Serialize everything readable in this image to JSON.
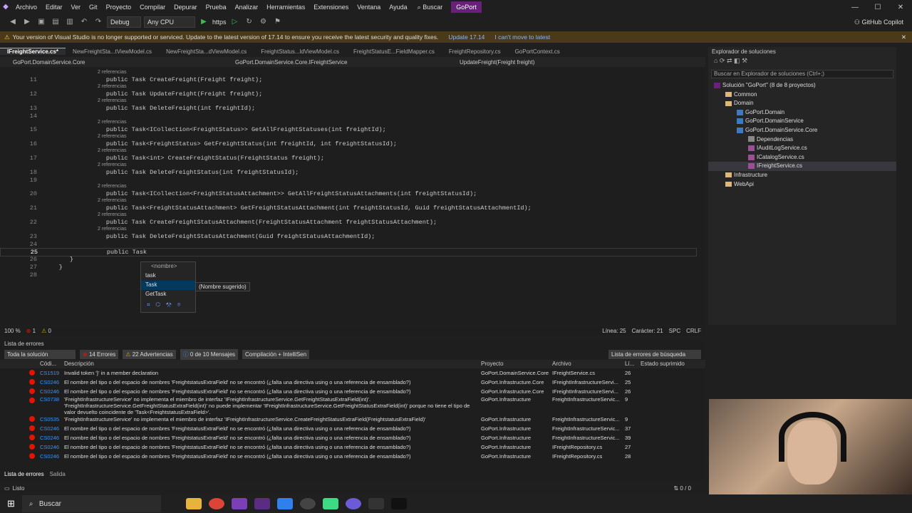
{
  "menu": [
    "Archivo",
    "Editar",
    "Ver",
    "Git",
    "Proyecto",
    "Compilar",
    "Depurar",
    "Prueba",
    "Analizar",
    "Herramientas",
    "Extensiones",
    "Ventana",
    "Ayuda"
  ],
  "search_label": "Buscar",
  "project_name": "GoPort",
  "toolbar": {
    "config": "Debug",
    "platform": "Any CPU",
    "run_target": "https",
    "copilot": "GitHub Copilot"
  },
  "infobar": {
    "message": "Your version of Visual Studio is no longer supported or serviced. Update to the latest version of 17.14 to ensure you receive the latest security and quality fixes.",
    "update_link": "Update 17.14",
    "dismiss_link": "I can't move to latest"
  },
  "tabs": [
    "IFreightService.cs*",
    "NewFreightSta...tViewModel.cs",
    "NewFreightSta...dViewModel.cs",
    "FreightStatus...ldViewModel.cs",
    "FreightStatusE...FieldMapper.cs",
    "FreightRepository.cs",
    "GoPortContext.cs"
  ],
  "navbar": {
    "project": "GoPort.DomainService.Core",
    "type": "GoPort.DomainService.Core.IFreightService",
    "member": "UpdateFreight(Freight freight)"
  },
  "code_refs": "2 referencias",
  "code": [
    {
      "n": "11",
      "t": "public Task CreateFreight(Freight freight);"
    },
    {
      "n": "12",
      "t": "public Task UpdateFreight(Freight freight);"
    },
    {
      "n": "13",
      "t": "public Task DeleteFreight(int freightId);"
    },
    {
      "n": "14",
      "t": ""
    },
    {
      "n": "15",
      "t": "public Task<ICollection<FreightStatus>> GetAllFreightStatuses(int freightId);"
    },
    {
      "n": "16",
      "t": "public Task<FreightStatus> GetFreightStatus(int freightId, int freightStatusId);"
    },
    {
      "n": "17",
      "t": "public Task<int> CreateFreightStatus(FreightStatus freight);"
    },
    {
      "n": "18",
      "t": "public Task DeleteFreightStatus(int freightStatusId);"
    },
    {
      "n": "19",
      "t": ""
    },
    {
      "n": "20",
      "t": "public Task<ICollection<FreightStatusAttachment>> GetAllFreightStatusAttachments(int freightStatusId);"
    },
    {
      "n": "21",
      "t": "public Task<FreightStatusAttachment> GetFreightStatusAttachment(int freightStatusId, Guid freightStatusAttachmentId);"
    },
    {
      "n": "22",
      "t": "public Task CreateFreightStatusAttachment(FreightStatusAttachment freightStatusAttachment);"
    },
    {
      "n": "23",
      "t": "public Task DeleteFreightStatusAttachment(Guid freightStatusAttachmentId);"
    },
    {
      "n": "24",
      "t": ""
    },
    {
      "n": "25",
      "t": "public Task"
    },
    {
      "n": "26",
      "t": "}"
    },
    {
      "n": "27",
      "t": "}"
    },
    {
      "n": "28",
      "t": ""
    }
  ],
  "autocomplete": {
    "header": "<nombre>",
    "items": [
      "task",
      "Task",
      "GetTask"
    ],
    "hint": "(Nombre sugerido)"
  },
  "editor_status": {
    "zoom": "100 %",
    "errors": "1",
    "warnings": "0",
    "line": "Línea: 25",
    "col": "Carácter: 21",
    "spc": "SPC",
    "eol": "CRLF"
  },
  "solution_explorer": {
    "title": "Explorador de soluciones",
    "search": "Buscar en Explorador de soluciones (Ctrl+;)",
    "items": [
      "Solución \"GoPort\" (8 de 8 proyectos)",
      "Common",
      "Domain",
      "GoPort.Domain",
      "GoPort.DomainService",
      "GoPort.DomainService.Core",
      "Dependencias",
      "IAuditLogService.cs",
      "ICatalogService.cs",
      "IFreightService.cs",
      "Infrastructure",
      "WebApi"
    ]
  },
  "error_list": {
    "title": "Lista de errores",
    "scope": "Toda la solución",
    "errors": "14 Errores",
    "warnings": "22 Advertencias",
    "messages": "0 de 10 Mensajes",
    "build": "Compilación + IntelliSen",
    "search": "Lista de errores de búsqueda",
    "columns": [
      "Códi...",
      "Descripción",
      "Proyecto",
      "Archivo",
      "Lí...",
      "Estado suprimido"
    ],
    "rows": [
      {
        "code": "CS1519",
        "desc": "Invalid token '}' in a member declaration",
        "proj": "GoPort.DomainService.Core",
        "file": "IFreightService.cs",
        "line": "26"
      },
      {
        "code": "CS0246",
        "desc": "El nombre del tipo o del espacio de nombres 'FreightstatusExtraField' no se encontró (¿falta una directiva using o una referencia de ensamblado?)",
        "proj": "GoPort.Infrastructure.Core",
        "file": "IFreightInfrastructureServi...",
        "line": "25"
      },
      {
        "code": "CS0246",
        "desc": "El nombre del tipo o del espacio de nombres 'FreightstatusExtraField' no se encontró (¿falta una directiva using o una referencia de ensamblado?)",
        "proj": "GoPort.Infrastructure.Core",
        "file": "IFreightInfrastructureServi...",
        "line": "26"
      },
      {
        "code": "CS0738",
        "desc": "'FreightInfrastructureService' no implementa el miembro de interfaz 'IFreightInfrastructureService.GetFreightStatusExtraField(int)'. 'FreightInfrastructureService.GetFreightStatusExtraField(int)' no puede implementar 'IFreightInfrastructureService.GetFreightStatusExtraField(int)' porque no tiene el tipo de valor devuelto coincidente de 'Task<FreightstatusExtraField>'.",
        "proj": "GoPort.Infrastructure",
        "file": "FreightInfrastructureServic...",
        "line": "9"
      },
      {
        "code": "CS0535",
        "desc": "'FreightInfrastructureService' no implementa el miembro de interfaz 'IFreightInfrastructureService.CreateFreightStatusExtraField(FreightstatusExtraField)'",
        "proj": "GoPort.Infrastructure",
        "file": "FreightInfrastructureServic...",
        "line": "9"
      },
      {
        "code": "CS0246",
        "desc": "El nombre del tipo o del espacio de nombres 'FreightstatusExtraField' no se encontró (¿falta una directiva using o una referencia de ensamblado?)",
        "proj": "GoPort.Infrastructure",
        "file": "FreightInfrastructureServic...",
        "line": "37"
      },
      {
        "code": "CS0246",
        "desc": "El nombre del tipo o del espacio de nombres 'FreightstatusExtraField' no se encontró (¿falta una directiva using o una referencia de ensamblado?)",
        "proj": "GoPort.Infrastructure",
        "file": "FreightInfrastructureServic...",
        "line": "39"
      },
      {
        "code": "CS0246",
        "desc": "El nombre del tipo o del espacio de nombres 'FreightstatusExtraField' no se encontró (¿falta una directiva using o una referencia de ensamblado?)",
        "proj": "GoPort.Infrastructure",
        "file": "IFreightRepository.cs",
        "line": "27"
      },
      {
        "code": "CS0246",
        "desc": "El nombre del tipo o del espacio de nombres 'FreightstatusExtraField' no se encontró (¿falta una directiva using o una referencia de ensamblado?)",
        "proj": "GoPort.Infrastructure",
        "file": "IFreightRepository.cs",
        "line": "28"
      }
    ]
  },
  "bottom_tabs": [
    "Lista de errores",
    "Salida"
  ],
  "status": {
    "ready": "Listo",
    "git": "0 / 0"
  },
  "taskbar": {
    "search": "Buscar"
  }
}
